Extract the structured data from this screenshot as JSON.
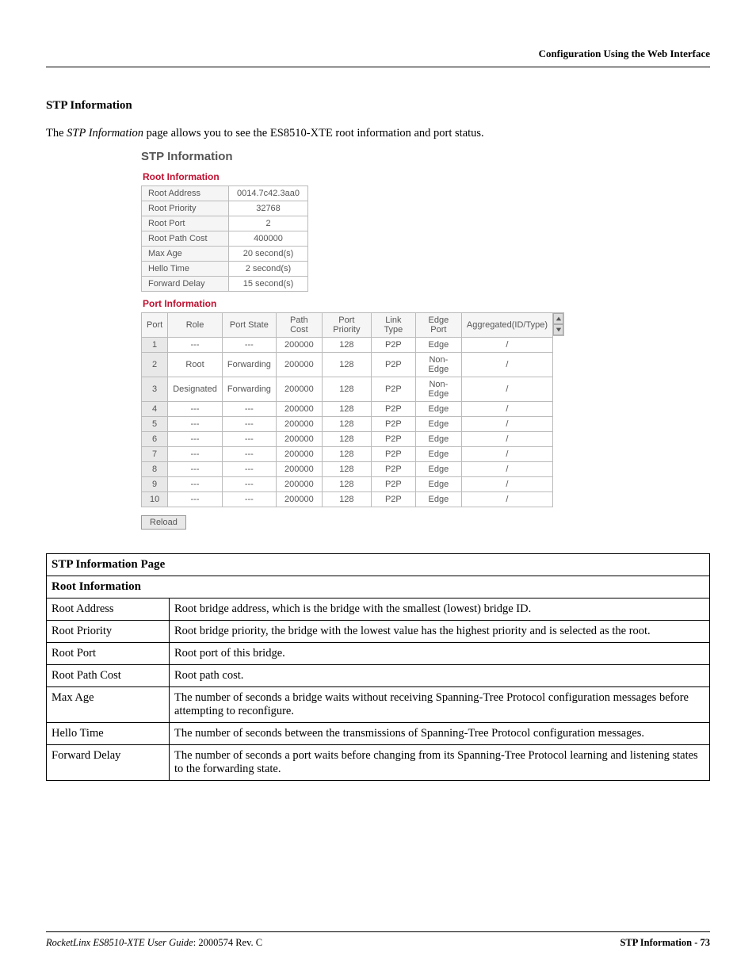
{
  "header": {
    "right": "Configuration Using the Web Interface"
  },
  "section_title": "STP Information",
  "intro": {
    "pre": "The ",
    "italic": "STP Information",
    "post": " page allows you to see the ES8510-XTE root information and port status."
  },
  "screenshot": {
    "heading": "STP Information",
    "root_heading": "Root Information",
    "root_rows": [
      {
        "label": "Root Address",
        "value": "0014.7c42.3aa0"
      },
      {
        "label": "Root Priority",
        "value": "32768"
      },
      {
        "label": "Root Port",
        "value": "2"
      },
      {
        "label": "Root Path Cost",
        "value": "400000"
      },
      {
        "label": "Max Age",
        "value": "20 second(s)"
      },
      {
        "label": "Hello Time",
        "value": "2 second(s)"
      },
      {
        "label": "Forward Delay",
        "value": "15 second(s)"
      }
    ],
    "port_heading": "Port Information",
    "port_headers": [
      "Port",
      "Role",
      "Port State",
      "Path Cost",
      "Port Priority",
      "Link Type",
      "Edge Port",
      "Aggregated(ID/Type)"
    ],
    "port_rows": [
      {
        "port": "1",
        "role": "---",
        "state": "---",
        "cost": "200000",
        "prio": "128",
        "link": "P2P",
        "edge": "Edge",
        "agg": "/"
      },
      {
        "port": "2",
        "role": "Root",
        "state": "Forwarding",
        "cost": "200000",
        "prio": "128",
        "link": "P2P",
        "edge": "Non-Edge",
        "agg": "/"
      },
      {
        "port": "3",
        "role": "Designated",
        "state": "Forwarding",
        "cost": "200000",
        "prio": "128",
        "link": "P2P",
        "edge": "Non-Edge",
        "agg": "/"
      },
      {
        "port": "4",
        "role": "---",
        "state": "---",
        "cost": "200000",
        "prio": "128",
        "link": "P2P",
        "edge": "Edge",
        "agg": "/"
      },
      {
        "port": "5",
        "role": "---",
        "state": "---",
        "cost": "200000",
        "prio": "128",
        "link": "P2P",
        "edge": "Edge",
        "agg": "/"
      },
      {
        "port": "6",
        "role": "---",
        "state": "---",
        "cost": "200000",
        "prio": "128",
        "link": "P2P",
        "edge": "Edge",
        "agg": "/"
      },
      {
        "port": "7",
        "role": "---",
        "state": "---",
        "cost": "200000",
        "prio": "128",
        "link": "P2P",
        "edge": "Edge",
        "agg": "/"
      },
      {
        "port": "8",
        "role": "---",
        "state": "---",
        "cost": "200000",
        "prio": "128",
        "link": "P2P",
        "edge": "Edge",
        "agg": "/"
      },
      {
        "port": "9",
        "role": "---",
        "state": "---",
        "cost": "200000",
        "prio": "128",
        "link": "P2P",
        "edge": "Edge",
        "agg": "/"
      },
      {
        "port": "10",
        "role": "---",
        "state": "---",
        "cost": "200000",
        "prio": "128",
        "link": "P2P",
        "edge": "Edge",
        "agg": "/"
      }
    ],
    "reload_label": "Reload"
  },
  "desc_table": {
    "title": "STP Information Page",
    "section": "Root Information",
    "rows": [
      {
        "label": "Root Address",
        "desc": "Root bridge address, which is the bridge with the smallest (lowest) bridge ID."
      },
      {
        "label": "Root Priority",
        "desc": "Root bridge priority, the bridge with the lowest value has the highest priority and is selected as the root."
      },
      {
        "label": "Root Port",
        "desc": "Root port of this bridge."
      },
      {
        "label": "Root Path Cost",
        "desc": "Root path cost."
      },
      {
        "label": "Max Age",
        "desc": "The number of seconds a bridge waits without receiving Spanning-Tree Protocol configuration messages before attempting to reconfigure."
      },
      {
        "label": "Hello Time",
        "desc": "The number of seconds between the transmissions of Spanning-Tree Protocol configuration messages."
      },
      {
        "label": "Forward Delay",
        "desc": "The number of seconds a port waits before changing from its Spanning-Tree Protocol learning and listening states to the forwarding state."
      }
    ]
  },
  "footer": {
    "left_italic": "RocketLinx ES8510-XTE User Guide",
    "left_rev": ": 2000574 Rev. C",
    "right": "STP Information - 73"
  }
}
